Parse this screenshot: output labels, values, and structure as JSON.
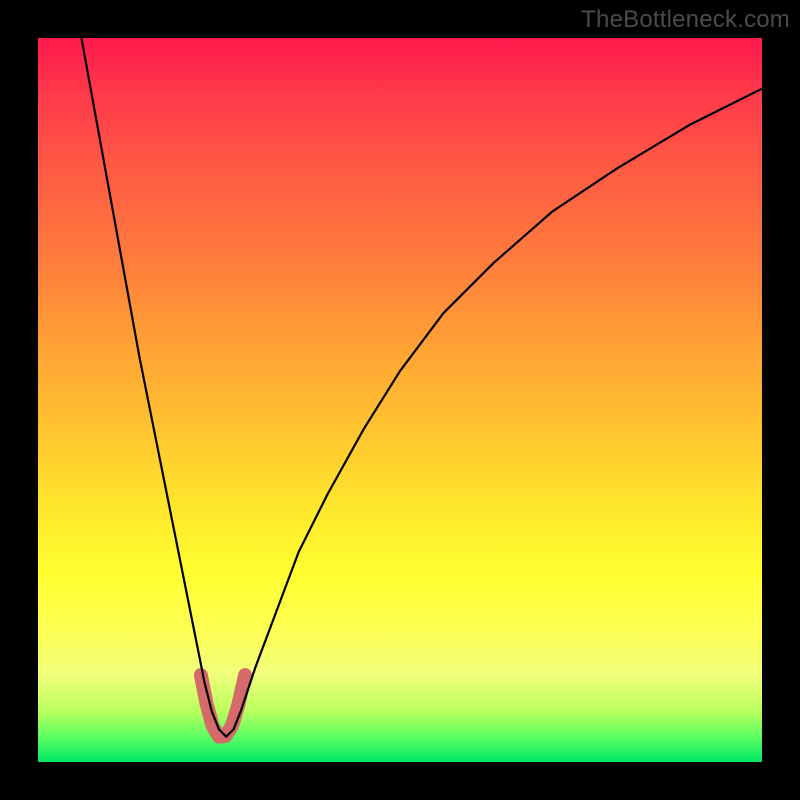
{
  "watermark": "TheBottleneck.com",
  "chart_data": {
    "type": "line",
    "title": "",
    "xlabel": "",
    "ylabel": "",
    "xlim": [
      0,
      100
    ],
    "ylim": [
      0,
      100
    ],
    "series": [
      {
        "name": "bottleneck-curve",
        "x": [
          6,
          8,
          10,
          12,
          14,
          16,
          18,
          20,
          22,
          23,
          24,
          25,
          26,
          27,
          28,
          30,
          33,
          36,
          40,
          45,
          50,
          56,
          63,
          71,
          80,
          90,
          100
        ],
        "y": [
          100,
          89,
          78,
          67,
          56,
          46,
          36,
          26,
          16,
          11,
          7,
          4.5,
          3.5,
          4.5,
          7,
          13,
          21,
          29,
          37,
          46,
          54,
          62,
          69,
          76,
          82,
          88,
          93
        ]
      }
    ],
    "highlight": {
      "name": "valley-marker",
      "color": "#d46a6a",
      "x": [
        22.5,
        23.3,
        24.1,
        25.0,
        25.9,
        26.8,
        27.7,
        28.6
      ],
      "y": [
        12,
        8,
        5,
        3.5,
        3.6,
        5,
        8,
        12
      ]
    },
    "background_gradient": {
      "top": "#ff1a4d",
      "bottom": "#00e765"
    }
  }
}
